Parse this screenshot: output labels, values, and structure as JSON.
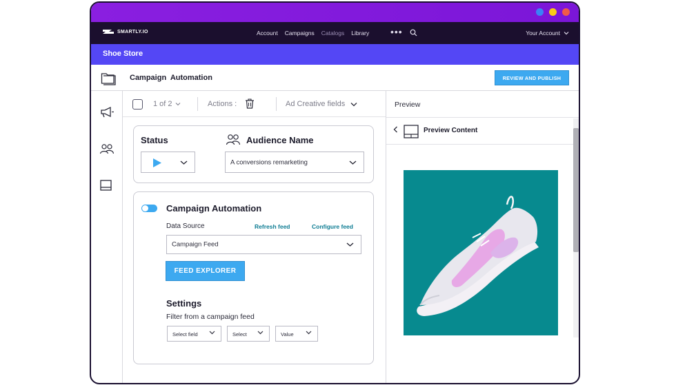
{
  "window": {
    "dots": [
      {
        "name": "blue-dot",
        "color": "#3b82f6"
      },
      {
        "name": "yellow-dot",
        "color": "#facc15"
      },
      {
        "name": "red-dot",
        "color": "#f05a48"
      }
    ]
  },
  "nav": {
    "logo_text": "SMARTLY.IO",
    "links": [
      "Account",
      "Campaigns",
      "Catalogs",
      "Library"
    ],
    "more": "•••",
    "account": "Your Account"
  },
  "store": {
    "name": "Shoe Store"
  },
  "header": {
    "title": "Campaign  Automation",
    "publish_label": "REVIEW AND PUBLISH"
  },
  "toolbar": {
    "count": "1 of 2",
    "actions_label": "Actions :",
    "fields_label": "Ad Creative fields"
  },
  "status_card": {
    "status_label": "Status",
    "audience_label": "Audience Name",
    "audience_value": "A conversions remarketing"
  },
  "automation_card": {
    "title": "Campaign Automation",
    "toggle_on": true,
    "data_source_label": "Data Source",
    "refresh_link": "Refresh feed",
    "configure_link": "Configure feed",
    "data_source_value": "Campaign Feed",
    "feed_explorer_label": "FEED EXPLORER",
    "settings_label": "Settings",
    "filter_label": "Filter from a campaign feed",
    "filters": [
      "Select field",
      "Select",
      "Value"
    ]
  },
  "preview": {
    "title": "Preview",
    "content_label": "Preview Content",
    "image_bg": "#078a8f"
  },
  "colors": {
    "accent": "#3da9f0",
    "store_bar": "#5447f5",
    "titlebar": "#8a1fe0",
    "nav_bg": "#1b0f2e",
    "link_teal": "#0d7c93"
  }
}
